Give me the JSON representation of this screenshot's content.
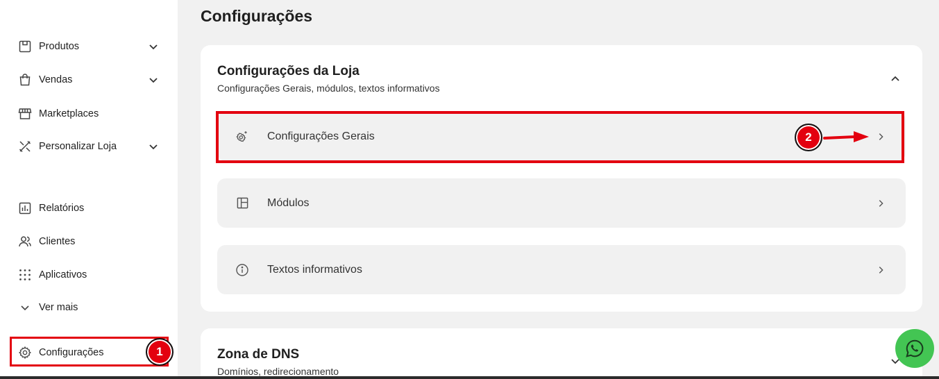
{
  "sidebar": {
    "items": [
      {
        "label": "Produtos",
        "icon": "box-icon",
        "has_chevron": true
      },
      {
        "label": "Vendas",
        "icon": "shopping-bag-icon",
        "has_chevron": true
      },
      {
        "label": "Marketplaces",
        "icon": "store-icon",
        "has_chevron": false
      },
      {
        "label": "Personalizar Loja",
        "icon": "brush-ruler-icon",
        "has_chevron": true
      },
      {
        "label": "Relatórios",
        "icon": "chart-icon",
        "has_chevron": false
      },
      {
        "label": "Clientes",
        "icon": "users-icon",
        "has_chevron": false
      },
      {
        "label": "Aplicativos",
        "icon": "grid-dots-icon",
        "has_chevron": false
      },
      {
        "label": "Ver mais",
        "icon": "chevron-down-icon",
        "has_chevron": false
      },
      {
        "label": "Configurações",
        "icon": "gear-icon",
        "has_chevron": false
      }
    ]
  },
  "annotations": {
    "badge_1": "1",
    "badge_2": "2",
    "highlight_color": "#e3000f"
  },
  "main": {
    "page_title": "Configurações",
    "store_card": {
      "title": "Configurações da Loja",
      "subtitle": "Configurações Gerais, módulos, textos informativos",
      "rows": [
        {
          "label": "Configurações Gerais",
          "icon": "gear-sparkle-icon"
        },
        {
          "label": "Módulos",
          "icon": "layout-icon"
        },
        {
          "label": "Textos informativos",
          "icon": "info-icon"
        }
      ]
    },
    "dns_card": {
      "title": "Zona de DNS",
      "subtitle": "Domínios, redirecionamento"
    }
  },
  "floating": {
    "whatsapp_icon": "whatsapp-icon",
    "whatsapp_color": "#43c553"
  }
}
